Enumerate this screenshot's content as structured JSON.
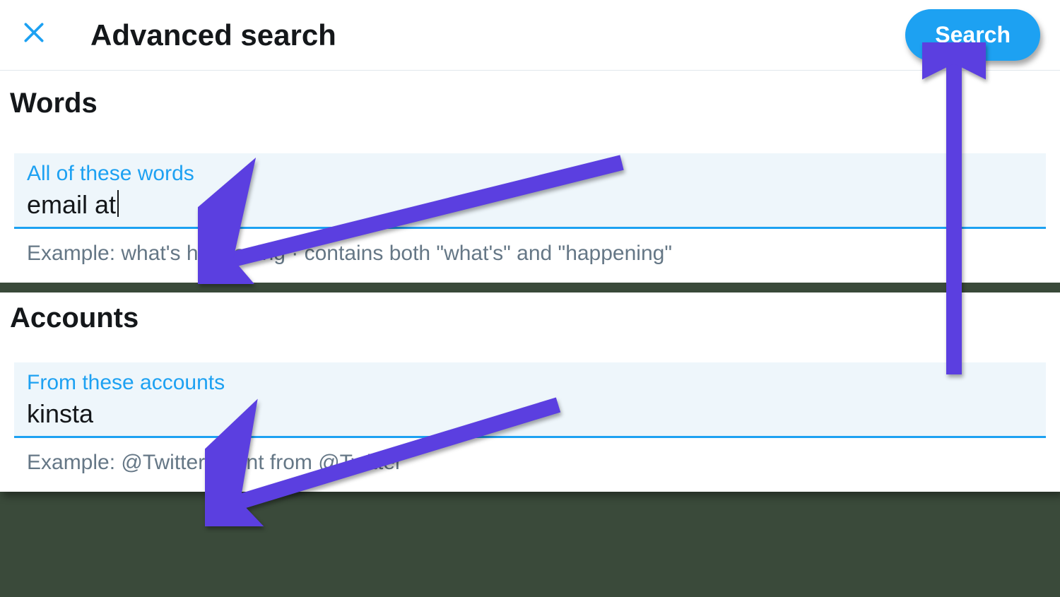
{
  "colors": {
    "accent": "#1da1f2",
    "annotation_arrow": "#5b3fe0",
    "text_primary": "#14171a",
    "text_muted": "#657786"
  },
  "header": {
    "title": "Advanced search",
    "search_label": "Search",
    "close_icon": "close-icon"
  },
  "sections": {
    "words": {
      "heading": "Words",
      "field_label": "All of these words",
      "field_value": "email at",
      "example": "Example: what's happening · contains both \"what's\" and \"happening\""
    },
    "accounts": {
      "heading": "Accounts",
      "field_label": "From these accounts",
      "field_value": "kinsta",
      "example": "Example: @Twitter · sent from @Twitter"
    }
  }
}
